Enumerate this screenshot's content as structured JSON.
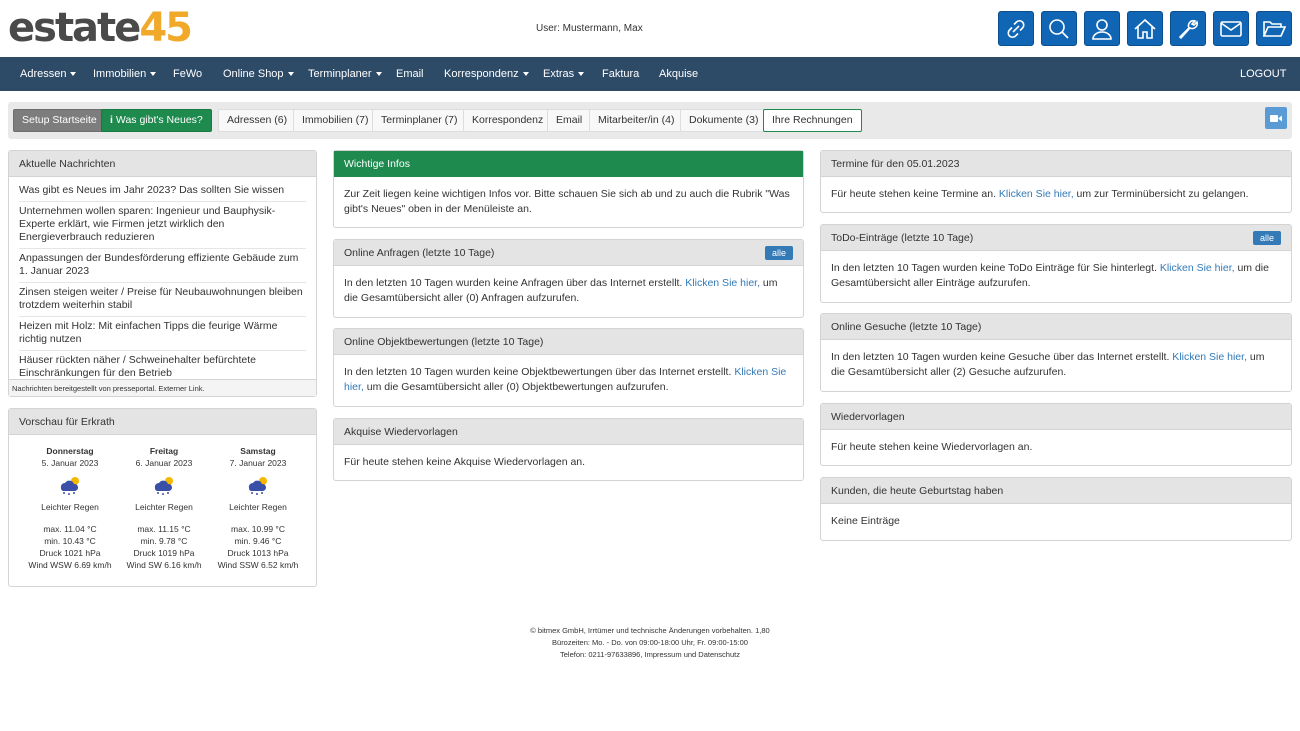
{
  "header": {
    "logo_part1": "estate",
    "logo_part2": "45",
    "user_label": "User: Mustermann, Max",
    "icons": [
      "link-icon",
      "search-icon",
      "user-icon",
      "home-icon",
      "wrench-icon",
      "mail-icon",
      "folder-open-icon"
    ]
  },
  "nav": {
    "items": [
      "Adressen",
      "Immobilien",
      "FeWo",
      "Online Shop",
      "Terminplaner",
      "Email",
      "Korrespondenz",
      "Extras",
      "Faktura",
      "Akquise"
    ],
    "logout": "LOGOUT"
  },
  "toolbar": {
    "setup": "Setup Startseite",
    "news": "Was gibt's Neues?",
    "tabs": [
      "Adressen (6)",
      "Immobilien (7)",
      "Terminplaner (7)",
      "Korrespondenz",
      "Email",
      "Mitarbeiter/in (4)",
      "Dokumente (3)",
      "Ihre Rechnungen"
    ]
  },
  "news": {
    "title": "Aktuelle Nachrichten",
    "items": [
      "Was gibt es Neues im Jahr 2023? Das sollten Sie wissen",
      "Unternehmen wollen sparen: Ingenieur und Bauphysik-Experte erklärt, wie Firmen jetzt wirklich den Energieverbrauch reduzieren",
      "Anpassungen der Bundesförderung effiziente Gebäude zum 1. Januar 2023",
      "Zinsen steigen weiter / Preise für Neubauwohnungen bleiben trotzdem weiterhin stabil",
      "Heizen mit Holz: Mit einfachen Tipps die feurige Wärme richtig nutzen",
      "Häuser rückten näher / Schweinehalter befürchtete Einschränkungen für den Betrieb"
    ],
    "footer": "Nachrichten bereitgestellt von presseportal. Externer Link."
  },
  "weather": {
    "title": "Vorschau für Erkrath",
    "days": [
      {
        "name": "Donnerstag",
        "date": "5. Januar 2023",
        "desc": "Leichter Regen",
        "max": "max. 11.04 °C",
        "min": "min. 10.43 °C",
        "pressure": "Druck 1021 hPa",
        "wind": "Wind WSW 6.69 km/h"
      },
      {
        "name": "Freitag",
        "date": "6. Januar 2023",
        "desc": "Leichter Regen",
        "max": "max. 11.15 °C",
        "min": "min. 9.78 °C",
        "pressure": "Druck 1019 hPa",
        "wind": "Wind SW 6.16 km/h"
      },
      {
        "name": "Samstag",
        "date": "7. Januar 2023",
        "desc": "Leichter Regen",
        "max": "max. 10.99 °C",
        "min": "min. 9.46 °C",
        "pressure": "Druck 1013 hPa",
        "wind": "Wind SSW 6.52 km/h"
      }
    ]
  },
  "center": {
    "infos_title": "Wichtige Infos",
    "infos_text": "Zur Zeit liegen keine wichtigen Infos vor. Bitte schauen Sie sich ab und zu auch die Rubrik \"Was gibt's Neues\" oben in der Menüleiste an.",
    "anfragen_title": "Online Anfragen (letzte 10 Tage)",
    "anfragen_badge": "alle",
    "anfragen_text1": "In den letzten 10 Tagen wurden keine Anfragen über das Internet erstellt. ",
    "anfragen_link": "Klicken Sie hier,",
    "anfragen_text2": " um die Gesamtübersicht aller (0) Anfragen aufzurufen.",
    "bewert_title": "Online Objektbewertungen (letzte 10 Tage)",
    "bewert_text1": "In den letzten 10 Tagen wurden keine Objektbewertungen über das Internet erstellt. ",
    "bewert_link": "Klicken Sie hier,",
    "bewert_text2": " um die Gesamtübersicht aller (0) Objektbewertungen aufzurufen.",
    "akquise_title": "Akquise Wiedervorlagen",
    "akquise_text": "Für heute stehen keine Akquise Wiedervorlagen an."
  },
  "right": {
    "termine_title": "Termine für den 05.01.2023",
    "termine_text1": "Für heute stehen keine Termine an. ",
    "termine_link": "Klicken Sie hier,",
    "termine_text2": " um zur Terminübersicht zu gelangen.",
    "todo_title": "ToDo-Einträge (letzte 10 Tage)",
    "todo_badge": "alle",
    "todo_text1": "In den letzten 10 Tagen wurden keine ToDo Einträge für Sie hinterlegt. ",
    "todo_link": "Klicken Sie hier,",
    "todo_text2": " um die Gesamtübersicht aller Einträge aufzurufen.",
    "gesuche_title": "Online Gesuche (letzte 10 Tage)",
    "gesuche_text1": "In den letzten 10 Tagen wurden keine Gesuche über das Internet erstellt. ",
    "gesuche_link": "Klicken Sie hier,",
    "gesuche_text2": " um die Gesamtübersicht aller (2) Gesuche aufzurufen.",
    "wv_title": "Wiedervorlagen",
    "wv_text": "Für heute stehen keine Wiedervorlagen an.",
    "geb_title": "Kunden, die heute Geburtstag haben",
    "geb_text": "Keine Einträge"
  },
  "footer": {
    "line1": "© bitmex GmbH, Irrtümer und technische Änderungen vorbehalten. 1,80",
    "line2": "Bürozeiten: Mo. - Do. von 09:00-18:00 Uhr, Fr. 09:00-15:00",
    "line3": "Telefon: 0211-97633896, Impressum und Datenschutz"
  },
  "colors": {
    "nav": "#2d4a67",
    "icon_button": "#1066b5",
    "green": "#1e8a4e",
    "logo_accent": "#f0a929"
  }
}
